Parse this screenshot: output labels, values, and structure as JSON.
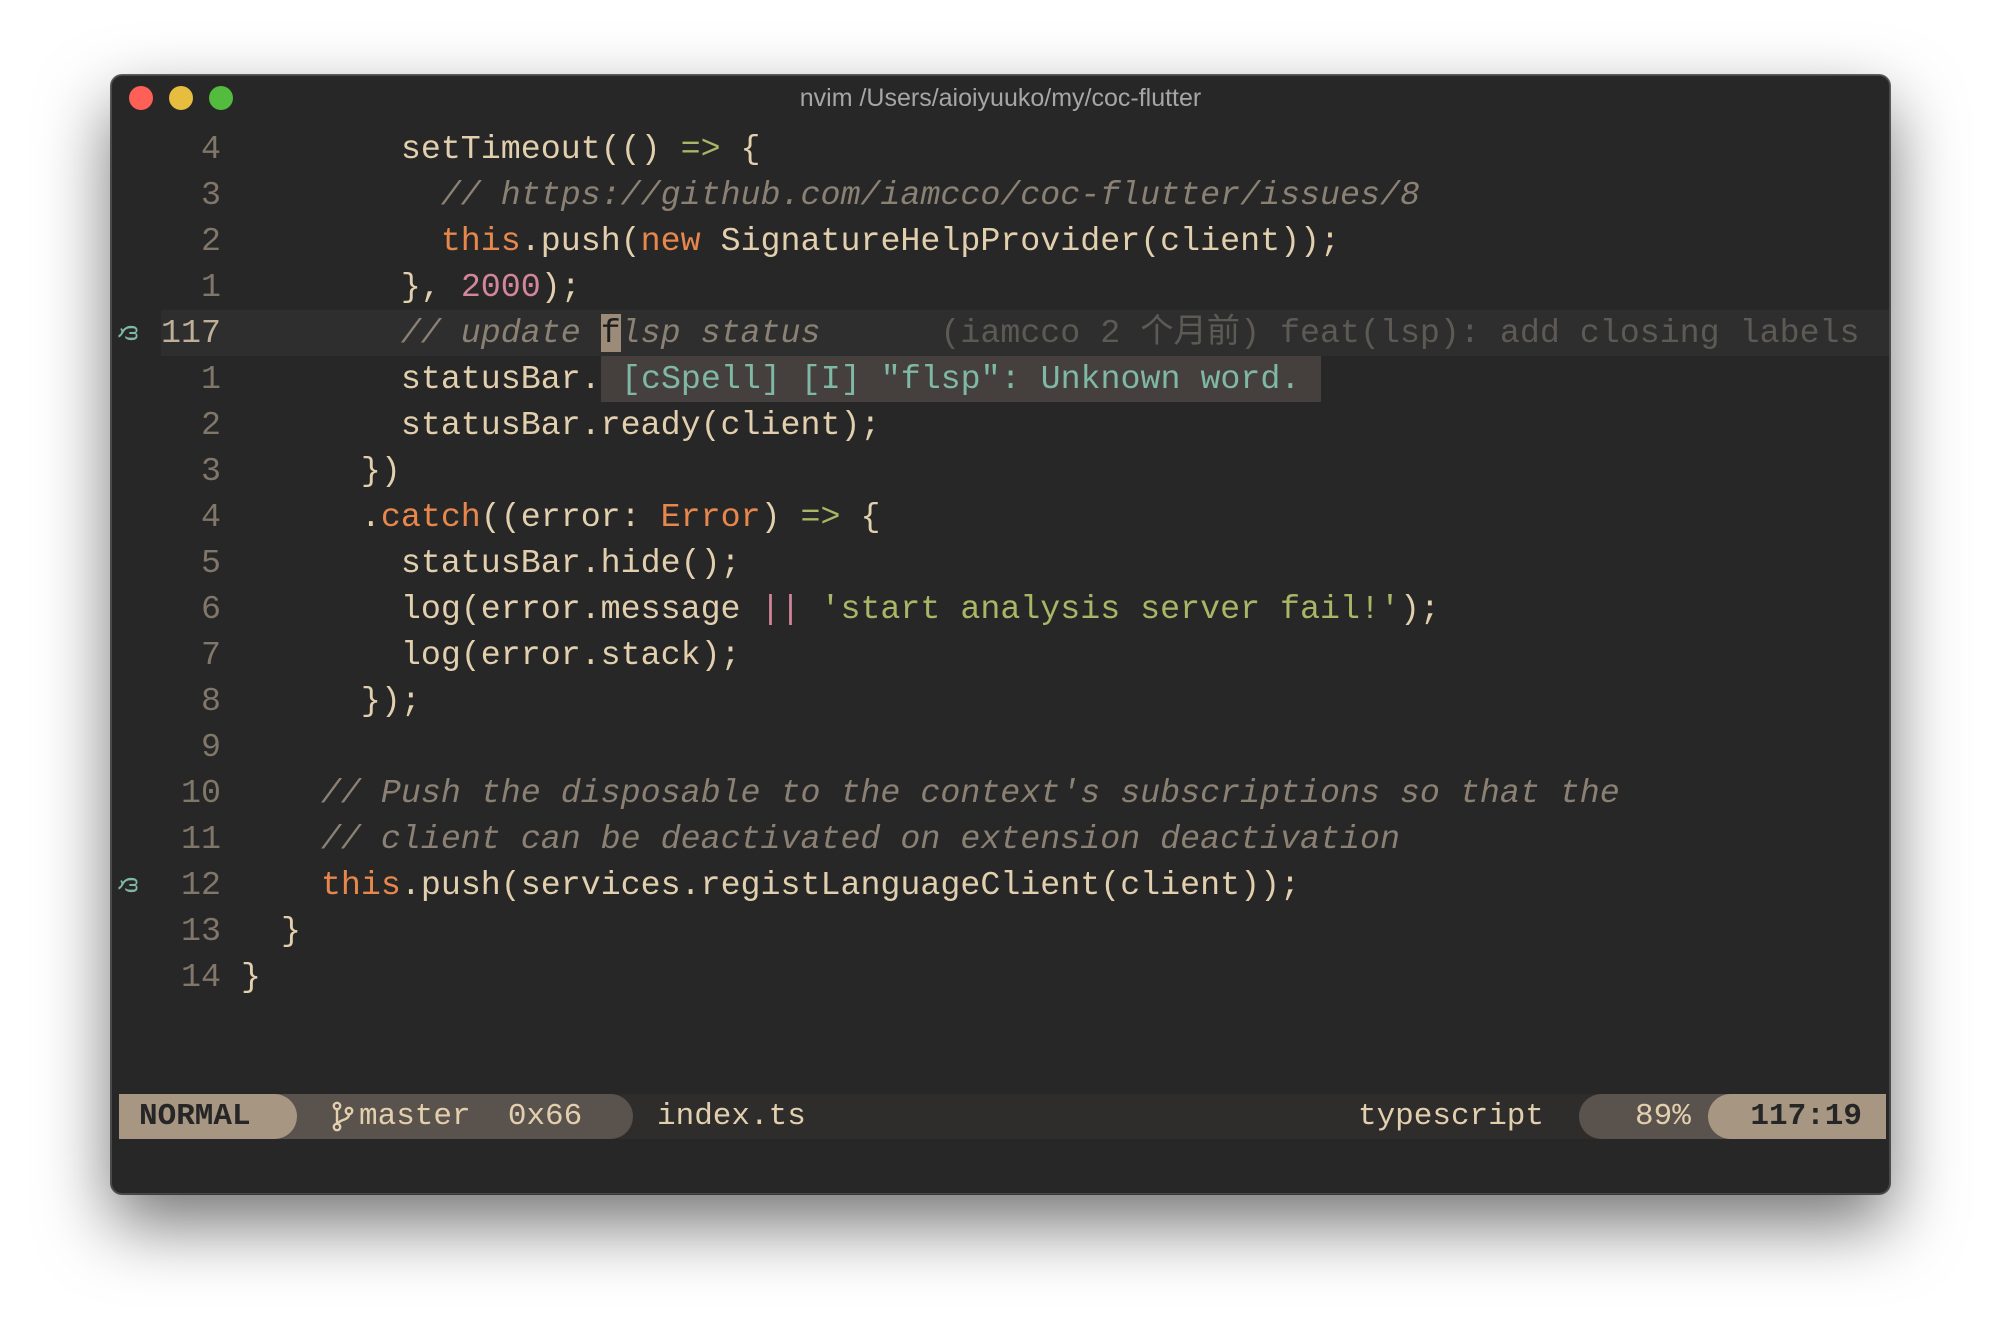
{
  "window": {
    "title": "nvim /Users/aioiyuuko/my/coc-flutter",
    "traffic_lights": [
      "close",
      "minimize",
      "zoom"
    ]
  },
  "editor": {
    "lines": [
      {
        "num": "4",
        "sign": "",
        "indent": "        ",
        "tokens": [
          [
            "",
            "setTimeout(() "
          ],
          [
            "op",
            "=>"
          ],
          [
            "",
            " {"
          ]
        ]
      },
      {
        "num": "3",
        "sign": "",
        "indent": "          ",
        "tokens": [
          [
            "cm",
            "// https://github.com/iamcco/coc-flutter/issues/8"
          ]
        ]
      },
      {
        "num": "2",
        "sign": "",
        "indent": "          ",
        "tokens": [
          [
            "kw",
            "this"
          ],
          [
            "",
            ".push("
          ],
          [
            "kw",
            "new"
          ],
          [
            "",
            " SignatureHelpProvider(client));"
          ]
        ]
      },
      {
        "num": "1",
        "sign": "",
        "indent": "        ",
        "tokens": [
          [
            "",
            "}, "
          ],
          [
            "num",
            "2000"
          ],
          [
            "",
            ");"
          ]
        ]
      },
      {
        "num": "117",
        "sign": "diagnostic-info",
        "current": true,
        "indent": "        ",
        "tokens": [
          [
            "cm",
            "// update "
          ],
          [
            "cursor",
            "f"
          ],
          [
            "cm",
            "lsp status"
          ]
        ],
        "blame": "      (iamcco 2 个月前) feat(lsp): add closing labels"
      },
      {
        "num": "1",
        "sign": "",
        "indent": "        ",
        "tokens": [
          [
            "",
            "statusBar."
          ]
        ],
        "float": " [cSpell] [I] \"flsp\": Unknown word."
      },
      {
        "num": "2",
        "sign": "",
        "indent": "        ",
        "tokens": [
          [
            "",
            "statusBar.ready(client);"
          ]
        ]
      },
      {
        "num": "3",
        "sign": "",
        "indent": "      ",
        "tokens": [
          [
            "",
            "})"
          ]
        ]
      },
      {
        "num": "4",
        "sign": "",
        "indent": "      ",
        "tokens": [
          [
            "",
            "."
          ],
          [
            "kw",
            "catch"
          ],
          [
            "",
            "((error: "
          ],
          [
            "kw",
            "Error"
          ],
          [
            "",
            ") "
          ],
          [
            "op",
            "=>"
          ],
          [
            "",
            " {"
          ]
        ]
      },
      {
        "num": "5",
        "sign": "",
        "indent": "        ",
        "tokens": [
          [
            "",
            "statusBar.hide();"
          ]
        ]
      },
      {
        "num": "6",
        "sign": "",
        "indent": "        ",
        "tokens": [
          [
            "",
            "log(error.message "
          ],
          [
            "pipe",
            "||"
          ],
          [
            "",
            " "
          ],
          [
            "str",
            "'start analysis server fail!'"
          ],
          [
            "",
            ");"
          ]
        ]
      },
      {
        "num": "7",
        "sign": "",
        "indent": "        ",
        "tokens": [
          [
            "",
            "log(error.stack);"
          ]
        ]
      },
      {
        "num": "8",
        "sign": "",
        "indent": "      ",
        "tokens": [
          [
            "",
            "});"
          ]
        ]
      },
      {
        "num": "9",
        "sign": "",
        "indent": "",
        "tokens": []
      },
      {
        "num": "10",
        "sign": "",
        "indent": "    ",
        "tokens": [
          [
            "cm",
            "// Push the disposable to the context's subscriptions so that the"
          ]
        ]
      },
      {
        "num": "11",
        "sign": "",
        "indent": "    ",
        "tokens": [
          [
            "cm",
            "// client can be deactivated on extension deactivation"
          ]
        ]
      },
      {
        "num": "12",
        "sign": "diagnostic-info",
        "indent": "    ",
        "tokens": [
          [
            "kw",
            "this"
          ],
          [
            "",
            ".push(services.registLanguageClient(client));"
          ]
        ]
      },
      {
        "num": "13",
        "sign": "",
        "indent": "  ",
        "tokens": [
          [
            "",
            "}"
          ]
        ]
      },
      {
        "num": "14",
        "sign": "",
        "indent": "",
        "tokens": [
          [
            "",
            "}"
          ]
        ]
      }
    ],
    "sign_glyph": "ღ"
  },
  "statusline": {
    "mode": "NORMAL",
    "branch_icon": "git-branch-icon",
    "branch": "master",
    "char_hex": "0x66",
    "filename": "index.ts",
    "filetype": "typescript",
    "percent": "89%",
    "position": "117:19"
  },
  "colors": {
    "background": "#272727",
    "foreground": "#e2cfae",
    "comment": "#8a8073",
    "keyword": "#e8874c",
    "number": "#d3869b",
    "string": "#a9b665",
    "diagnostic": "#7fb8a4",
    "mode_bg": "#a69682",
    "segment_bg": "#5a524c"
  }
}
